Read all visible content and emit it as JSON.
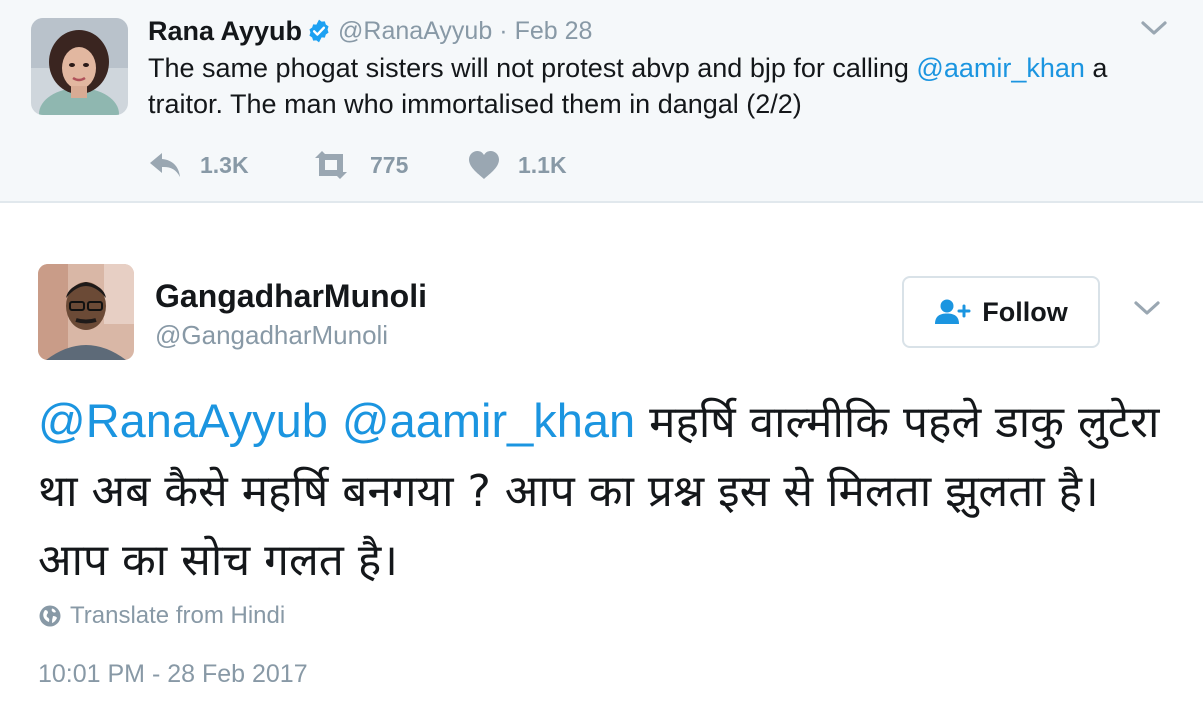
{
  "parent_tweet": {
    "author_name": "Rana Ayyub",
    "author_handle": "@RanaAyyub",
    "separator": "·",
    "date": "Feb 28",
    "text_before": "The same phogat sisters will not protest abvp and bjp for calling ",
    "text_mention": "@aamir_khan",
    "text_after": " a traitor. The man who immortalised them in dangal (2/2)",
    "reply_count": "1.3K",
    "retweet_count": "775",
    "like_count": "1.1K"
  },
  "main_tweet": {
    "author_name": "GangadharMunoli",
    "author_handle": "@GangadharMunoli",
    "follow_label": "Follow",
    "mention_1": "@RanaAyyub",
    "mention_2": "@aamir_khan",
    "text_body": " महर्षि वाल्मीकि पहले डाकु लुटेरा था अब कैसे महर्षि बनगया ? आप का प्रश्न इस से मिलता झुलता है। आप का सोच गलत है।",
    "translate_label": "Translate from Hindi",
    "timestamp": "10:01 PM - 28 Feb 2017"
  },
  "icons": {
    "verified": "verified-badge-icon",
    "chevron": "chevron-down-icon",
    "reply": "reply-icon",
    "retweet": "retweet-icon",
    "like": "heart-icon",
    "follow": "add-user-icon",
    "translate": "globe-icon"
  },
  "colors": {
    "link": "#1b95e0",
    "secondary_text": "#8899a6",
    "primary_text": "#14171a",
    "parent_background": "#f5f8fa",
    "verified_badge": "#1da1f2"
  }
}
